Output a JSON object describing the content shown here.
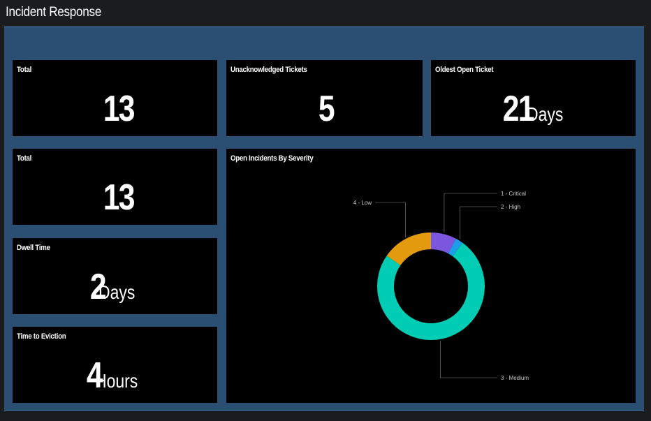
{
  "header": {
    "title": "Incident Response"
  },
  "panels": {
    "total_top": {
      "title": "Total",
      "value": "13",
      "unit": ""
    },
    "unacknowledged": {
      "title": "Unacknowledged Tickets",
      "value": "5",
      "unit": ""
    },
    "oldest_open": {
      "title": "Oldest Open Ticket",
      "value": "21",
      "unit": "Days"
    },
    "total_mid": {
      "title": "Total",
      "value": "13",
      "unit": ""
    },
    "dwell_time": {
      "title": "Dwell Time",
      "value": "2",
      "unit": "Days"
    },
    "time_to_eviction": {
      "title": "Time to Eviction",
      "value": "4",
      "unit": "Hours"
    },
    "severity_chart": {
      "title": "Open Incidents By Severity"
    }
  },
  "colors": {
    "background": "#1b1c1e",
    "canvas": "#2b4f73",
    "panel": "#000000",
    "critical": "#7b57e0",
    "high": "#1e9ee8",
    "medium": "#00cdb4",
    "low": "#e39a0c"
  },
  "chart_data": {
    "type": "pie",
    "title": "Open Incidents By Severity",
    "categories": [
      "1 - Critical",
      "2 - High",
      "3 - Medium",
      "4 - Low"
    ],
    "values": [
      1,
      0.3,
      9.7,
      2
    ],
    "colors": [
      "#7b57e0",
      "#1e9ee8",
      "#00cdb4",
      "#e39a0c"
    ],
    "donut": true
  }
}
